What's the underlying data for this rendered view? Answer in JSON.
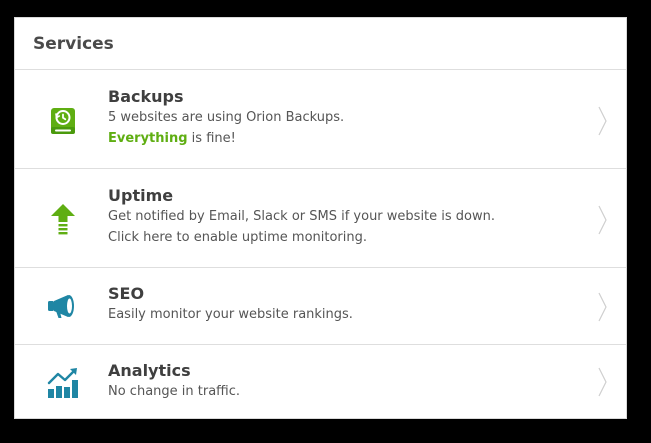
{
  "panel": {
    "title": "Services"
  },
  "services": [
    {
      "title": "Backups",
      "line1": "5 websites are using Orion Backups.",
      "status_highlight": "Everything",
      "status_rest": " is fine!",
      "icon": "backup-drive-icon"
    },
    {
      "title": "Uptime",
      "line1": "Get notified by Email, Slack or SMS if your website is down.",
      "line2": "Click here to enable uptime monitoring.",
      "icon": "uptime-arrow-icon"
    },
    {
      "title": "SEO",
      "line1": "Easily monitor your website rankings.",
      "icon": "megaphone-icon"
    },
    {
      "title": "Analytics",
      "line1": "No change in traffic.",
      "icon": "analytics-chart-icon"
    }
  ],
  "colors": {
    "green": "#5fae12",
    "teal": "#1f86a4"
  }
}
